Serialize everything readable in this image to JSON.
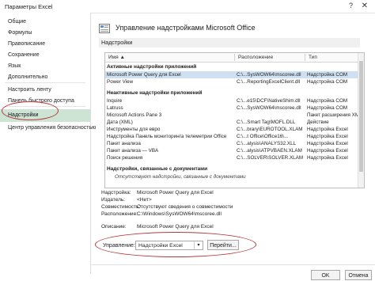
{
  "window": {
    "title": "Параметры Excel",
    "help_glyph": "?",
    "close_glyph": "✕"
  },
  "sidebar": {
    "items": [
      {
        "label": "Общие"
      },
      {
        "label": "Формулы"
      },
      {
        "label": "Правописание"
      },
      {
        "label": "Сохранение"
      },
      {
        "label": "Язык"
      },
      {
        "label": "Дополнительно"
      },
      {
        "label": "Настроить ленту"
      },
      {
        "label": "Панель быстрого доступа"
      },
      {
        "label": "Надстройки"
      },
      {
        "label": "Центр управления безопасностью"
      }
    ],
    "selected_index": 8
  },
  "header": {
    "title": "Управление надстройками Microsoft Office"
  },
  "section_label": "Надстройки",
  "table": {
    "headers": [
      "Имя ▲",
      "Расположение",
      "Тип"
    ],
    "groups": [
      {
        "title": "Активные надстройки приложений",
        "rows": [
          [
            "Microsoft Power Query для Excel",
            "C:\\...SysWOW64\\mscoree.dll",
            "Надстройка COM"
          ],
          [
            "Power View",
            "C:\\...ReportingExcelClient.dll",
            "Надстройка COM"
          ]
        ]
      },
      {
        "title": "Неактивные надстройки приложений",
        "rows": [
          [
            "Inquire",
            "C:\\...e15\\DCF\\NativeShim.dll",
            "Надстройка COM"
          ],
          [
            "Latruss",
            "C:\\...SysWOW64\\mscoree.dll",
            "Надстройка COM"
          ],
          [
            "Microsoft Actions Pane 3",
            "",
            "Пакет расширения XML"
          ],
          [
            "Дата (XML)",
            "C:\\...Smart Tag\\MOFL.DLL",
            "Действие"
          ],
          [
            "Инструменты для евро",
            "C:\\...brary\\EUROTOOL.XLAM",
            "Надстройка Excel"
          ],
          [
            "Надстройка Панель мониторинга телеметрии Office",
            "C:\\...t Office\\Office16\\...",
            "Надстройка Excel"
          ],
          [
            "Пакет анализа",
            "C:\\...alysis\\ANALYS32.XLL",
            "Надстройка Excel"
          ],
          [
            "Пакет анализа — VBA",
            "C:\\...alysis\\ATPVBAEN.XLAM",
            "Надстройка Excel"
          ],
          [
            "Поиск решения",
            "C:\\...SOLVER\\SOLVER.XLAM",
            "Надстройка Excel"
          ]
        ]
      },
      {
        "title": "Надстройки, связанные с документами",
        "note": "Отсутствуют надстройки, связанные с документами",
        "rows": []
      }
    ]
  },
  "details": {
    "addin_label": "Надстройка:",
    "addin": "Microsoft Power Query для Excel",
    "publisher_label": "Издатель:",
    "publisher": "<Нет>",
    "compat_label": "Совместимость:",
    "compat": "Отсутствуют сведения о совместимости",
    "location_label": "Расположение:",
    "location": "C:\\Windows\\SysWOW64\\mscoree.dll",
    "desc_label": "Описание:",
    "desc": "Microsoft Power Query для Excel"
  },
  "manage": {
    "label": "Управление:",
    "selected": "Надстройки Excel",
    "arrow": "▾",
    "go_label": "Перейти..."
  },
  "footer": {
    "ok_label": "OK",
    "cancel_label": "Отмена"
  },
  "colors": {
    "selected_nav": "#cde3d4",
    "annotation": "#b73a3a",
    "selected_row": "#cfe0f3"
  }
}
